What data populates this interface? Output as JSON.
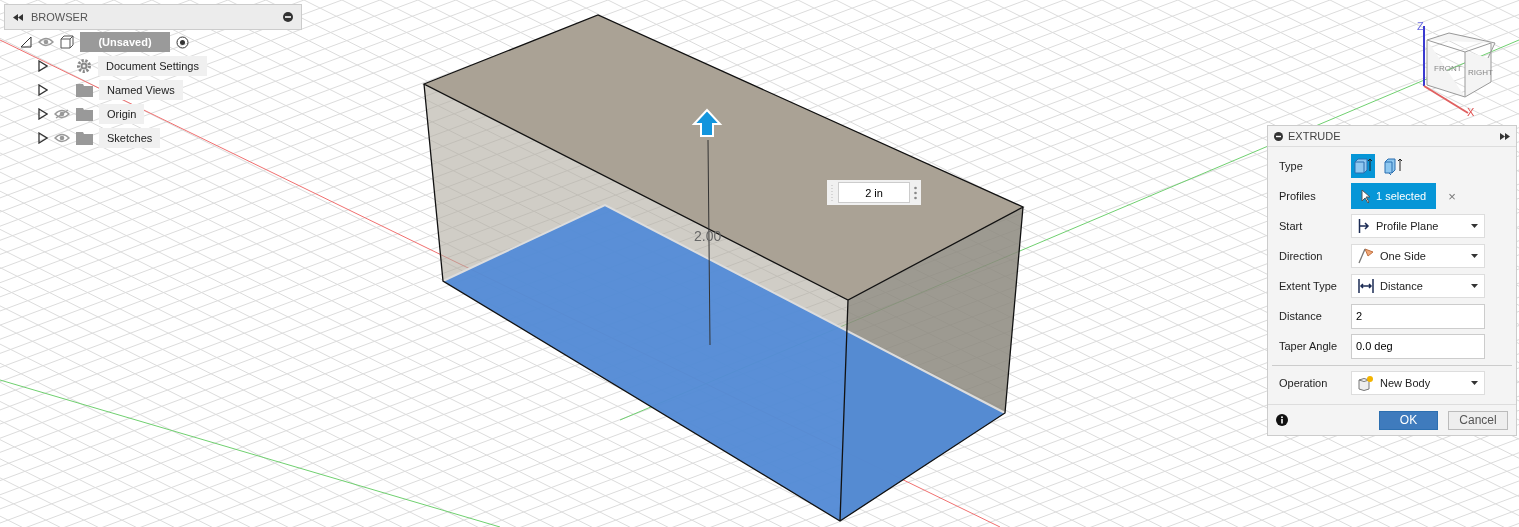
{
  "browser": {
    "title": "BROWSER",
    "items": [
      {
        "label": "(Unsaved)",
        "kind": "component",
        "expanded": true,
        "visible": true,
        "children": [
          {
            "label": "Document Settings",
            "kind": "settings",
            "expanded": false
          },
          {
            "label": "Named Views",
            "kind": "folder",
            "expanded": false
          },
          {
            "label": "Origin",
            "kind": "folder",
            "expanded": false,
            "visible": false
          },
          {
            "label": "Sketches",
            "kind": "folder",
            "expanded": false,
            "visible": true
          }
        ]
      }
    ]
  },
  "viewport": {
    "dimension_label": "2.00",
    "distance_field": "2 in",
    "view_cube": {
      "faces": [
        "FRONT",
        "RIGHT"
      ],
      "axes": [
        "Z",
        "X"
      ]
    }
  },
  "extrude": {
    "title": "EXTRUDE",
    "rows": [
      {
        "kind": "type",
        "label": "Type",
        "options": [
          {
            "selected": true
          },
          {
            "selected": false
          }
        ]
      },
      {
        "kind": "selection",
        "label": "Profiles",
        "value": "1 selected",
        "clear": "×"
      },
      {
        "kind": "dropdown",
        "label": "Start",
        "value": "Profile Plane"
      },
      {
        "kind": "dropdown",
        "label": "Direction",
        "value": "One Side"
      },
      {
        "kind": "dropdown",
        "label": "Extent Type",
        "value": "Distance"
      },
      {
        "kind": "input",
        "label": "Distance",
        "value": "2"
      },
      {
        "kind": "input",
        "label": "Taper Angle",
        "value": "0.0 deg"
      },
      {
        "kind": "divider"
      },
      {
        "kind": "dropdown",
        "label": "Operation",
        "value": "New Body"
      }
    ],
    "ok": "OK",
    "cancel": "Cancel"
  }
}
